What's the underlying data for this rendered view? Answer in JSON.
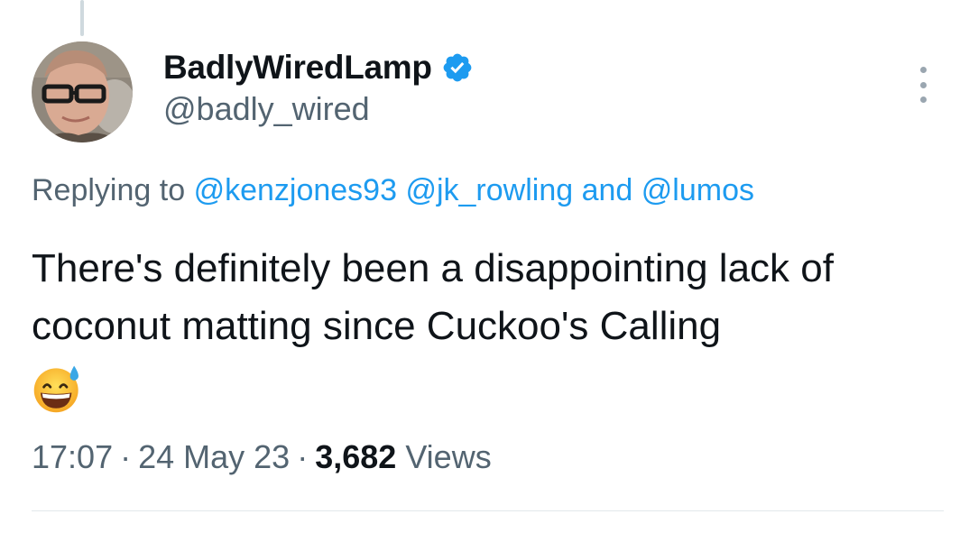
{
  "author": {
    "display_name": "BadlyWiredLamp",
    "handle": "@badly_wired",
    "verified": true
  },
  "reply": {
    "prefix": "Replying to",
    "mentions": [
      "@kenzjones93",
      "@jk_rowling"
    ],
    "joiner": "and",
    "last_mention": "@lumos"
  },
  "tweet": {
    "text": "There's definitely been a disappointing lack of coconut matting since Cuckoo's Calling",
    "emoji": "grinning-face-with-sweat"
  },
  "meta": {
    "time": "17:07",
    "separator": "·",
    "date": "24 May 23",
    "views_count": "3,682",
    "views_label": "Views"
  },
  "colors": {
    "accent": "#1d9bf0",
    "text": "#0f1419",
    "muted": "#536471",
    "divider": "#e3e8eb"
  },
  "icons": {
    "verified": "verified-badge-icon",
    "more": "more-options-icon"
  }
}
